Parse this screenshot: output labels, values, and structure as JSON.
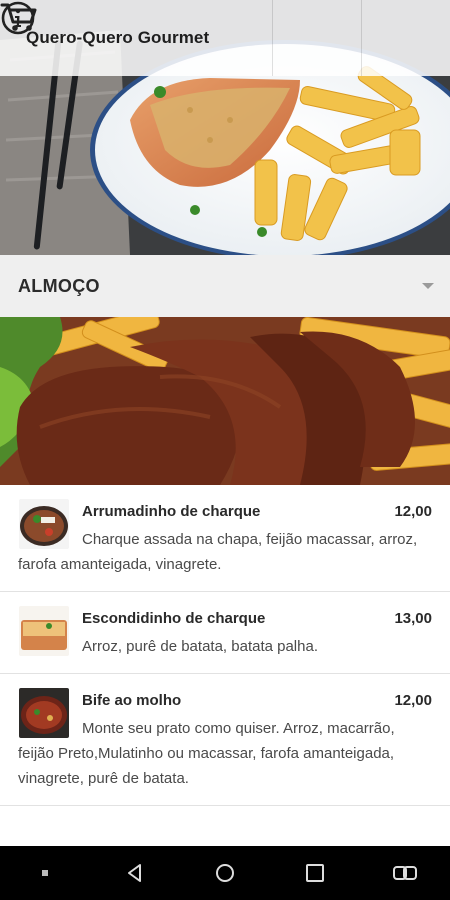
{
  "app": {
    "title": "Quero-Quero Gourmet"
  },
  "topbar": {
    "info_icon": "info-icon",
    "cart_icon": "cart-icon"
  },
  "section": {
    "label": "ALMOÇO",
    "toggle_icon": "dropdown-arrow-icon"
  },
  "menu": {
    "items": [
      {
        "name": "Arrumadinho de charque",
        "price": "12,00",
        "description": "Charque assada na chapa, feijão macassar, arroz, farofa amanteigada, vinagrete."
      },
      {
        "name": "Escondidinho de charque",
        "price": "13,00",
        "description": "Arroz, purê de batata, batata palha."
      },
      {
        "name": "Bife ao molho",
        "price": "12,00",
        "description": "Monte seu prato como quiser. Arroz, macarrão, feijão Preto,Mulatinho ou macassar, farofa amanteigada, vinagrete, purê de batata."
      }
    ]
  },
  "navbar": {
    "buttons": [
      "square-dot-icon",
      "back-icon",
      "home-icon",
      "recents-icon",
      "switch-icon"
    ]
  },
  "colors": {
    "section_bg": "#efefef",
    "navbar_bg": "#000000",
    "text_dark": "#2a2a2a"
  }
}
